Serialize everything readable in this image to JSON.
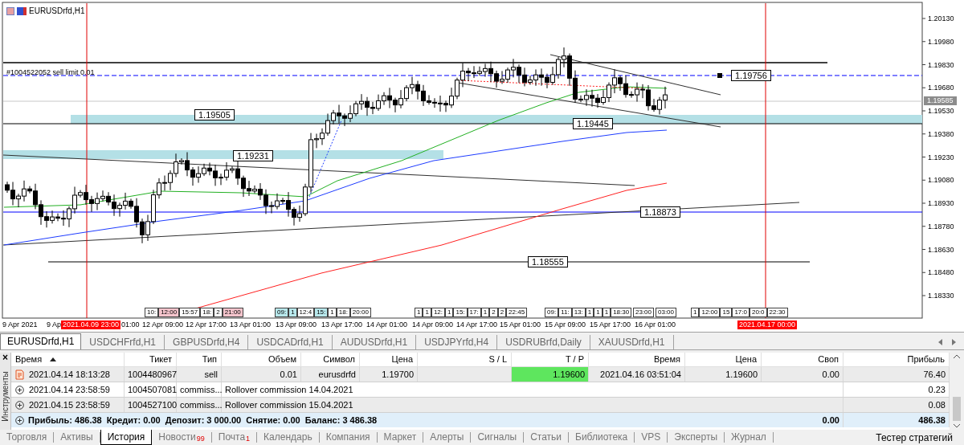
{
  "chart": {
    "title": "EURUSDrfd,H1",
    "order_label": "#1004522052 sell limit 0.01",
    "price_axis": [
      "1.20130",
      "1.19980",
      "1.19830",
      "1.19680",
      "1.19530",
      "1.19380",
      "1.19230",
      "1.19080",
      "1.18930",
      "1.18780",
      "1.18630",
      "1.18480",
      "1.18330"
    ],
    "current_price": "1.19585",
    "level_labels": [
      "1.19756",
      "1.19505",
      "1.19445",
      "1.19231",
      "1.18873",
      "1.18555"
    ],
    "time_axis": [
      "9 Apr 2021",
      "9 Ap",
      "01:00",
      "12 Apr 09:00",
      "12 Apr 17:00",
      "13 Apr 01:00",
      "13 Apr 09:00",
      "13 Apr 17:00",
      "14 Apr 01:00",
      "14 Apr 09:00",
      "14 Apr 17:00",
      "15 Apr 01:00",
      "15 Apr 09:00",
      "15 Apr 17:00",
      "16 Apr 01:00"
    ],
    "time_markers": [
      "2021.04.09 23:00",
      "2021.04.17 00:00"
    ],
    "event_flags": [
      [
        {
          "text": "10:",
          "color": "#ffffff"
        },
        {
          "text": "12:00",
          "color": "#f4c4cc"
        },
        {
          "text": "15:57",
          "color": "#ffffff"
        },
        {
          "text": "18:",
          "color": "#ffffff"
        },
        {
          "text": "2",
          "color": "#ffffff"
        },
        {
          "text": "21:00",
          "color": "#f4c4cc"
        }
      ],
      [
        {
          "text": "09:",
          "color": "#b8e8ec"
        },
        {
          "text": "1",
          "color": "#b8e8ec"
        },
        {
          "text": "12:4",
          "color": "#ffffff"
        },
        {
          "text": "15:",
          "color": "#b8e8ec"
        },
        {
          "text": "1",
          "color": "#ffffff"
        },
        {
          "text": "18:",
          "color": "#ffffff"
        },
        {
          "text": "20:00",
          "color": "#ffffff"
        }
      ],
      [
        {
          "text": "1",
          "color": "#ffffff"
        },
        {
          "text": "1",
          "color": "#ffffff"
        },
        {
          "text": "12:",
          "color": "#ffffff"
        },
        {
          "text": "1",
          "color": "#ffffff"
        },
        {
          "text": "15:",
          "color": "#ffffff"
        },
        {
          "text": "17:",
          "color": "#ffffff"
        },
        {
          "text": "1",
          "color": "#ffffff"
        },
        {
          "text": "2",
          "color": "#ffffff"
        },
        {
          "text": "2",
          "color": "#ffffff"
        },
        {
          "text": "22:45",
          "color": "#ffffff"
        }
      ],
      [
        {
          "text": "09:",
          "color": "#ffffff"
        },
        {
          "text": "11:",
          "color": "#ffffff"
        },
        {
          "text": "13:",
          "color": "#ffffff"
        },
        {
          "text": "1",
          "color": "#ffffff"
        },
        {
          "text": "1",
          "color": "#ffffff"
        },
        {
          "text": "1",
          "color": "#ffffff"
        },
        {
          "text": "18:30",
          "color": "#ffffff"
        }
      ],
      [
        {
          "text": "23:00",
          "color": "#ffffff"
        }
      ],
      [
        {
          "text": "03:00",
          "color": "#ffffff"
        }
      ],
      [
        {
          "text": "1",
          "color": "#ffffff"
        },
        {
          "text": "12:00",
          "color": "#ffffff"
        },
        {
          "text": "15",
          "color": "#ffffff"
        },
        {
          "text": "17:0",
          "color": "#ffffff"
        },
        {
          "text": "20:0",
          "color": "#ffffff"
        },
        {
          "text": "22:30",
          "color": "#ffffff"
        }
      ]
    ]
  },
  "chart_tabs": [
    {
      "label": "EURUSDrfd,H1",
      "selected": true
    },
    {
      "label": "USDCHFrfd,H1",
      "selected": false
    },
    {
      "label": "GBPUSDrfd,H4",
      "selected": false
    },
    {
      "label": "USDCADrfd,H1",
      "selected": false
    },
    {
      "label": "AUDUSDrfd,H1",
      "selected": false
    },
    {
      "label": "USDJPYrfd,H4",
      "selected": false
    },
    {
      "label": "USDRUBrfd,Daily",
      "selected": false
    },
    {
      "label": "XAUUSDrfd,H1",
      "selected": false
    }
  ],
  "side_panel": {
    "close": "×",
    "title": "Инструменты"
  },
  "history_table": {
    "columns": [
      {
        "label": "Время",
        "sorted": true
      },
      {
        "label": "Тикет",
        "sorted": false
      },
      {
        "label": "Тип",
        "sorted": false
      },
      {
        "label": "Объем",
        "sorted": false
      },
      {
        "label": "Символ",
        "sorted": false
      },
      {
        "label": "Цена",
        "sorted": false
      },
      {
        "label": "S / L",
        "sorted": false
      },
      {
        "label": "T / P",
        "sorted": false
      },
      {
        "label": "Время",
        "sorted": false
      },
      {
        "label": "Цена",
        "sorted": false
      },
      {
        "label": "Своп",
        "sorted": false
      },
      {
        "label": "Прибыль",
        "sorted": false
      }
    ],
    "rows": [
      {
        "kind": "deal",
        "time": "2021.04.14 18:13:28",
        "ticket": "1004480967",
        "type": "sell",
        "volume": "0.01",
        "symbol": "eurusdrfd",
        "price": "1.19700",
        "tp": "1.19600",
        "tp_reached": true,
        "close_time": "2021.04.16 03:51:04",
        "close_price": "1.19600",
        "swap": "0.00",
        "profit": "76.40"
      },
      {
        "kind": "balance",
        "time": "2021.04.14 23:58:59",
        "ticket": "1004507081",
        "type": "commiss...",
        "comment": "Rollover commission 14.04.2021",
        "profit": "0.23"
      },
      {
        "kind": "balance",
        "time": "2021.04.15 23:58:59",
        "ticket": "1004527100",
        "type": "commiss...",
        "comment": "Rollover commission 15.04.2021",
        "profit": "0.08"
      }
    ],
    "summary": {
      "text": "Прибыль: 486.38  Кредит: 0.00  Депозит: 3 000.00  Снятие: 0.00  Баланс: 3 486.38",
      "swap": "0.00",
      "profit": "486.38"
    }
  },
  "bottom_tabs": [
    {
      "label": "Торговля",
      "selected": false
    },
    {
      "label": "Активы",
      "selected": false
    },
    {
      "label": "История",
      "selected": true
    },
    {
      "label": "Новости",
      "selected": false,
      "badge": "99"
    },
    {
      "label": "Почта",
      "selected": false,
      "badge": "1"
    },
    {
      "label": "Календарь",
      "selected": false
    },
    {
      "label": "Компания",
      "selected": false
    },
    {
      "label": "Маркет",
      "selected": false
    },
    {
      "label": "Алерты",
      "selected": false
    },
    {
      "label": "Сигналы",
      "selected": false
    },
    {
      "label": "Статьи",
      "selected": false
    },
    {
      "label": "Библиотека",
      "selected": false
    },
    {
      "label": "VPS",
      "selected": false
    },
    {
      "label": "Эксперты",
      "selected": false
    },
    {
      "label": "Журнал",
      "selected": false
    }
  ],
  "strategy_tester": "Тестер стратегий"
}
